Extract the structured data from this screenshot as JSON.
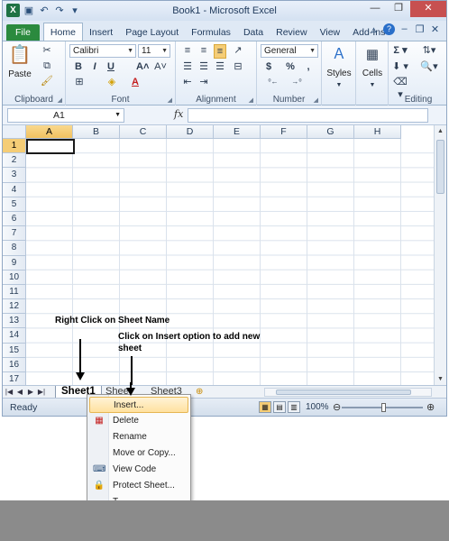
{
  "window": {
    "title": "Book1 - Microsoft Excel",
    "app_icon_letter": "X",
    "qat_icons": [
      "save-icon",
      "undo-icon",
      "redo-icon",
      "customize-icon"
    ],
    "controls": [
      "minimize-icon",
      "restore-icon",
      "close-icon"
    ]
  },
  "ribbon_tabs": [
    "File",
    "Home",
    "Insert",
    "Page Layout",
    "Formulas",
    "Data",
    "Review",
    "View",
    "Add-Ins"
  ],
  "active_tab": "Home",
  "ribbon": {
    "clipboard": {
      "label": "Clipboard",
      "paste": "Paste"
    },
    "font": {
      "label": "Font",
      "name": "Calibri",
      "size": "11",
      "bold": "B",
      "italic": "I",
      "underline": "U"
    },
    "alignment": {
      "label": "Alignment"
    },
    "number": {
      "label": "Number",
      "format": "General",
      "currency": "$",
      "percent": "%",
      "comma": ","
    },
    "styles": {
      "label": "Styles"
    },
    "cells": {
      "label": "Cells"
    },
    "editing": {
      "label": "Editing"
    }
  },
  "formula_bar": {
    "name_box": "A1",
    "fx": "fx",
    "value": ""
  },
  "grid": {
    "columns": [
      "A",
      "B",
      "C",
      "D",
      "E",
      "F",
      "G",
      "H"
    ],
    "rows": [
      "1",
      "2",
      "3",
      "4",
      "5",
      "6",
      "7",
      "8",
      "9",
      "10",
      "11",
      "12",
      "13",
      "14",
      "15",
      "16",
      "17"
    ],
    "active_cell": "A1"
  },
  "annotations": {
    "right_click": "Right Click on Sheet Name",
    "insert_line1": "Click on Insert option to add new",
    "insert_line2": "sheet"
  },
  "sheets": {
    "tabs": [
      "Sheet1",
      "Sheet2",
      "Sheet3"
    ],
    "active": "Sheet1",
    "visible_labels": [
      "Sheet1",
      "Shee",
      "Sheet3"
    ]
  },
  "status_bar": {
    "ready": "Ready",
    "zoom": "100%"
  },
  "context_menu": {
    "items": [
      {
        "label": "Insert...",
        "icon": "",
        "highlighted": true
      },
      {
        "label": "Delete",
        "icon": "delete-sheet-icon"
      },
      {
        "label": "Rename",
        "icon": ""
      },
      {
        "label": "Move or Copy...",
        "icon": ""
      },
      {
        "label": "View Code",
        "icon": "view-code-icon"
      },
      {
        "label": "Protect Sheet...",
        "icon": "protect-sheet-icon"
      },
      {
        "label": "T",
        "icon": ""
      }
    ]
  },
  "colors": {
    "file_tab": "#2b8a3e",
    "title_text": "#1e395b",
    "selection": "#f5cd76",
    "menu_highlight": "#ffe19f"
  }
}
